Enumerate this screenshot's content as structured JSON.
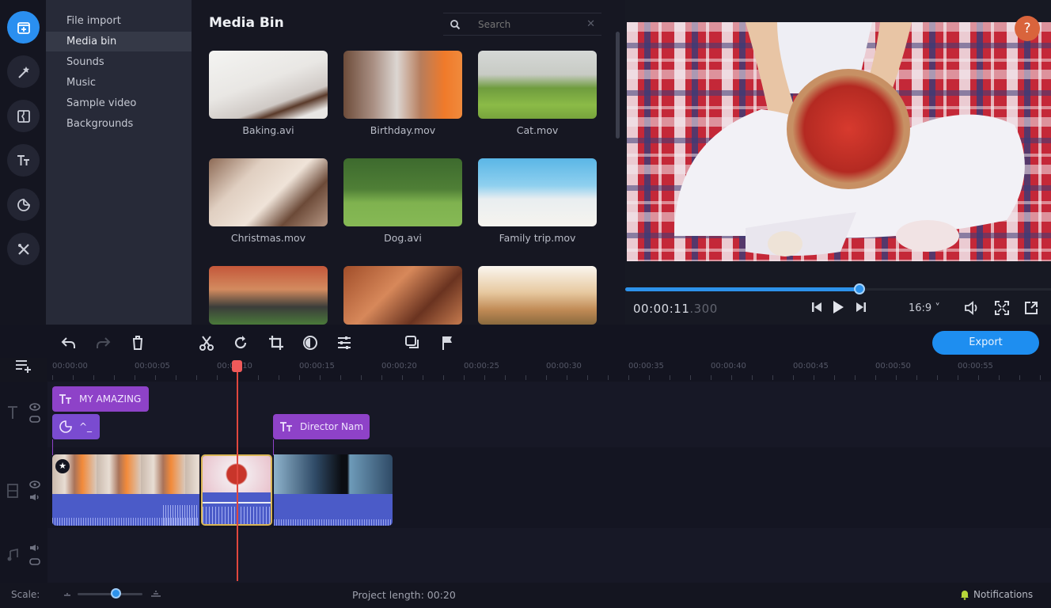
{
  "sidebar": {
    "rail": [
      {
        "name": "import-icon",
        "active": true
      },
      {
        "name": "magic-wand-icon",
        "active": false
      },
      {
        "name": "transitions-icon",
        "active": false
      },
      {
        "name": "titles-icon",
        "active": false
      },
      {
        "name": "stickers-icon",
        "active": false
      },
      {
        "name": "tools-icon",
        "active": false
      }
    ],
    "categories": [
      "File import",
      "Media bin",
      "Sounds",
      "Music",
      "Sample video",
      "Backgrounds"
    ],
    "active_category": "Media bin"
  },
  "media_bin": {
    "title": "Media Bin",
    "search_placeholder": "Search",
    "items": [
      {
        "label": "Baking.avi"
      },
      {
        "label": "Birthday.mov"
      },
      {
        "label": "Cat.mov"
      },
      {
        "label": "Christmas.mov"
      },
      {
        "label": "Dog.avi"
      },
      {
        "label": "Family trip.mov"
      },
      {
        "label": ""
      },
      {
        "label": ""
      },
      {
        "label": ""
      }
    ]
  },
  "preview": {
    "help_label": "?",
    "timecode_main": "00:00:11",
    "timecode_ms": ".300",
    "progress": 0.55,
    "aspect_ratio": "16:9 ˅"
  },
  "toolbar": {
    "export_label": "Export"
  },
  "timeline": {
    "ruler_labels": [
      "00:00:00",
      "00:00:05",
      "00:00:10",
      "00:00:15",
      "00:00:20",
      "00:00:25",
      "00:00:30",
      "00:00:35",
      "00:00:40",
      "00:00:45",
      "00:00:50",
      "00:00:55"
    ],
    "title_clips": [
      {
        "label": "MY AMAZING"
      },
      {
        "label": "^_"
      },
      {
        "label": "Director Nam"
      }
    ],
    "playhead_time": "00:00:11"
  },
  "status": {
    "scale_label": "Scale:",
    "scale_value": 0.6,
    "project_length": "Project length:  00:20",
    "notifications": "Notifications"
  },
  "colors": {
    "accent": "#1e8ef0",
    "title_clip": "#8e42c8",
    "playhead": "#e0473e",
    "help": "#d9643c"
  }
}
